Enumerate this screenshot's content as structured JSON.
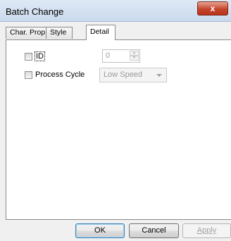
{
  "window": {
    "title": "Batch Change",
    "close_glyph": "x"
  },
  "tabs": [
    {
      "label": "Char. Prop.",
      "active": false
    },
    {
      "label": "Style",
      "active": false
    },
    {
      "label": "Detail",
      "active": true
    }
  ],
  "detail": {
    "id_checkbox": {
      "label": "ID",
      "checked": false
    },
    "id_value": "0",
    "process_cycle_checkbox": {
      "label": "Process Cycle",
      "checked": false
    },
    "process_cycle_value": "Low Speed"
  },
  "buttons": {
    "ok": "OK",
    "cancel": "Cancel",
    "apply": "Apply"
  },
  "colors": {
    "title_bar": "#c9d9ec",
    "close_button": "#c4442c",
    "default_button_border": "#3c7fb1",
    "disabled_text": "#a0a0a0"
  },
  "icons": [
    "close-icon",
    "spin-up-icon",
    "spin-down-icon",
    "dropdown-arrow-icon"
  ]
}
